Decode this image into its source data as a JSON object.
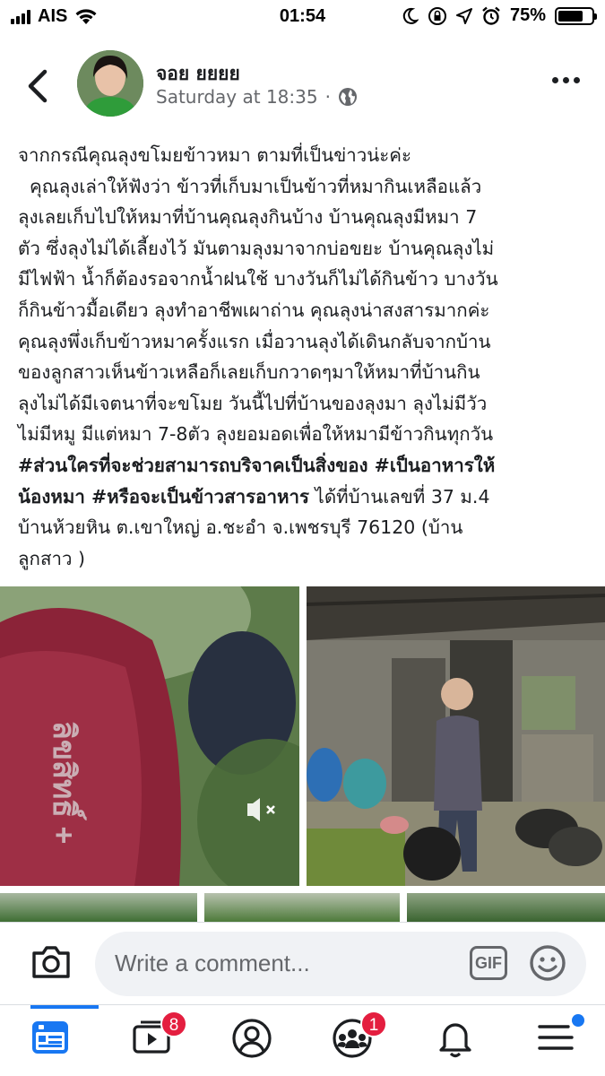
{
  "status_bar": {
    "carrier": "AIS",
    "time": "01:54",
    "battery": "75%",
    "battery_level": 0.75
  },
  "post": {
    "author": "จอย ยยยย",
    "timestamp": "Saturday at 18:35",
    "separator": "·",
    "privacy_icon": "globe-icon",
    "lines": [
      {
        "text": "จากกรณีคุณลุงขโมยข้าวหมา ตามที่เป็นข่าวน่ะค่ะ",
        "bold": false
      },
      {
        "text": "  คุณลุงเล่าให้ฟังว่า ข้าวที่เก็บมาเป็นข้าวที่หมากินเหลือแล้ว",
        "bold": false
      },
      {
        "text": "ลุงเลยเก็บไปให้หมาที่บ้านคุณลุงกินบ้าง บ้านคุณลุงมีหมา 7",
        "bold": false
      },
      {
        "text": "ตัว ซึ่งลุงไม่ได้เลี้ยงไว้ มันตามลุงมาจากบ่อขยะ บ้านคุณลุงไม่",
        "bold": false
      },
      {
        "text": "มีไฟฟ้า น้ำก็ต้องรอจากน้ำฝนใช้ บางวันก็ไม่ได้กินข้าว บางวัน",
        "bold": false
      },
      {
        "text": "ก็กินข้าวมื้อเดียว ลุงทำอาชีพเผาถ่าน คุณลุงน่าสงสารมากค่ะ",
        "bold": false
      },
      {
        "text": "คุณลุงพึ่งเก็บข้าวหมาครั้งแรก เมื่อวานลุงได้เดินกลับจากบ้าน",
        "bold": false
      },
      {
        "text": "ของลูกสาวเห็นข้าวเหลือก็เลยเก็บกวาดๆมาให้หมาที่บ้านกิน",
        "bold": false
      },
      {
        "text": "ลุงไม่ได้มีเจตนาที่จะขโมย วันนี้ไปที่บ้านของลุงมา ลุงไม่มีวัว",
        "bold": false
      },
      {
        "text": "ไม่มีหมู มีแต่หมา 7-8ตัว ลุงยอมอดเพื่อให้หมามีข้าวกินทุกวัน",
        "bold": false
      }
    ],
    "hashtag_line_1": "#ส่วนใครที่จะช่วยสามารถบริจาคเป็นสิ่งของ #เป็นอาหารให้",
    "hashtag_line_2a": "น้องหมา #หรือจะเป็นข้าวสารอาหาร",
    "hashtag_line_2b": " ได้ที่บ้านเลขที่ 37 ม.4",
    "address_line_3": "บ้านห้วยหิน ต.เขาใหญ่ อ.ชะอำ จ.เพชรบุรี 76120 (บ้าน",
    "address_line_4": "ลูกสาว )"
  },
  "media": {
    "video_muted_icon": "speaker-muted-icon"
  },
  "comment_bar": {
    "placeholder": "Write a comment...",
    "gif_label": "GIF"
  },
  "tab_bar": {
    "watch_badge": "8",
    "groups_badge": "1"
  }
}
